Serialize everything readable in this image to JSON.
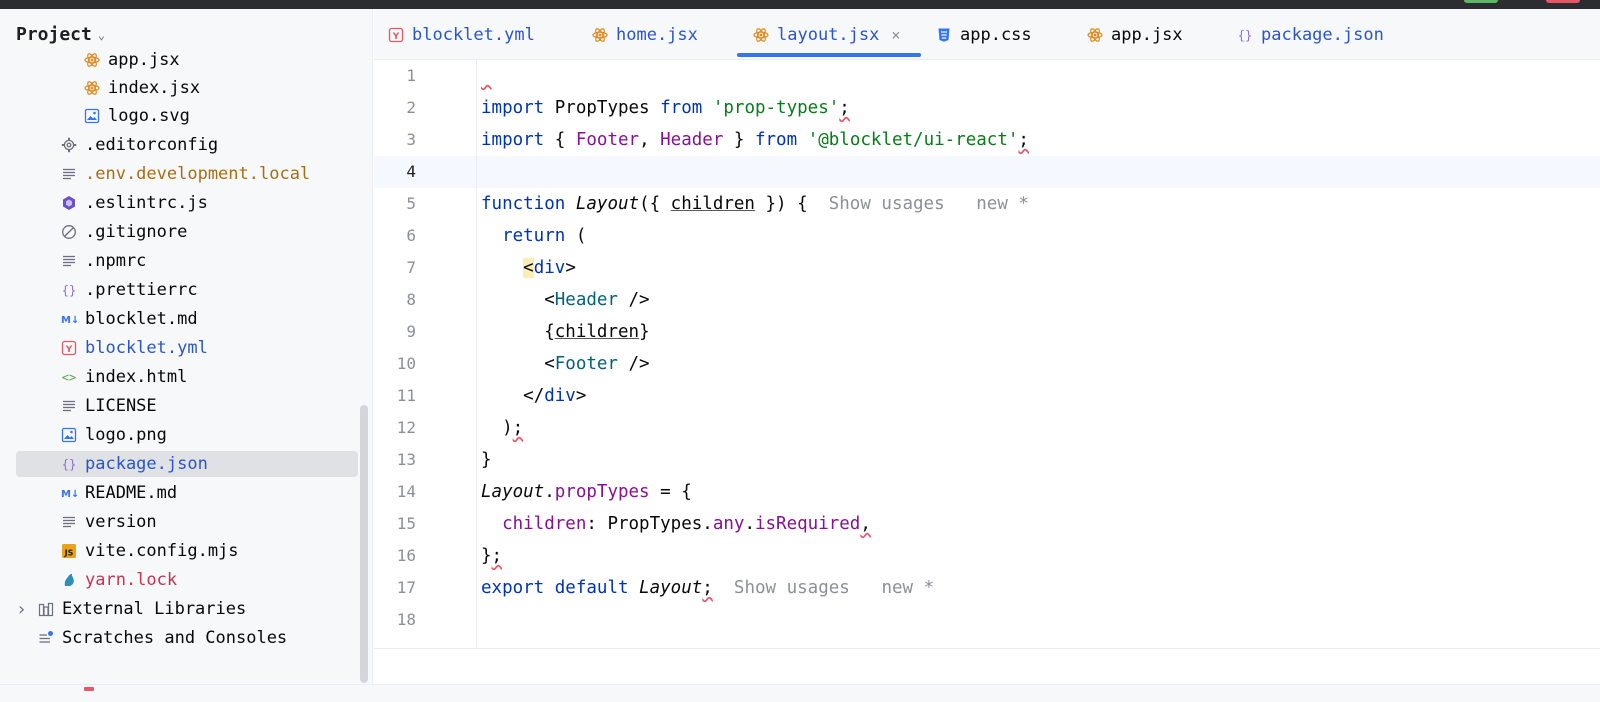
{
  "project": {
    "title": "Project"
  },
  "tree": [
    {
      "label": "app.jsx",
      "icon": "react-icon",
      "color": "#080808"
    },
    {
      "label": "index.jsx",
      "icon": "react-icon",
      "color": "#080808"
    },
    {
      "label": "logo.svg",
      "icon": "image-icon",
      "color": "#080808"
    },
    {
      "label": ".editorconfig",
      "icon": "gear-icon",
      "color": "#080808"
    },
    {
      "label": ".env.development.local",
      "icon": "text-file-icon",
      "color": "#a86d12"
    },
    {
      "label": ".eslintrc.js",
      "icon": "eslint-icon",
      "color": "#080808"
    },
    {
      "label": ".gitignore",
      "icon": "ignore-icon",
      "color": "#080808"
    },
    {
      "label": ".npmrc",
      "icon": "text-file-icon",
      "color": "#080808"
    },
    {
      "label": ".prettierrc",
      "icon": "json-icon",
      "color": "#080808"
    },
    {
      "label": "blocklet.md",
      "icon": "markdown-icon",
      "color": "#080808"
    },
    {
      "label": "blocklet.yml",
      "icon": "yaml-icon",
      "color": "#2a55c8"
    },
    {
      "label": "index.html",
      "icon": "html-icon",
      "color": "#080808"
    },
    {
      "label": "LICENSE",
      "icon": "text-file-icon",
      "color": "#080808"
    },
    {
      "label": "logo.png",
      "icon": "image-icon",
      "color": "#080808"
    },
    {
      "label": "package.json",
      "icon": "json-icon",
      "color": "#2a55c8"
    },
    {
      "label": "README.md",
      "icon": "markdown-icon",
      "color": "#080808"
    },
    {
      "label": "version",
      "icon": "text-file-icon",
      "color": "#080808"
    },
    {
      "label": "vite.config.mjs",
      "icon": "js-icon",
      "color": "#080808"
    },
    {
      "label": "yarn.lock",
      "icon": "yarn-icon",
      "color": "#c7334b"
    },
    {
      "label": "External Libraries",
      "icon": "library-icon",
      "color": "#080808"
    },
    {
      "label": "Scratches and Consoles",
      "icon": "scratches-icon",
      "color": "#080808"
    }
  ],
  "tabs": [
    {
      "label": "blocklet.yml",
      "icon": "yaml-icon",
      "color": "#2a55c8"
    },
    {
      "label": "home.jsx",
      "icon": "react-icon",
      "color": "#2a55c8"
    },
    {
      "label": "layout.jsx",
      "icon": "react-icon",
      "color": "#2a55c8",
      "active": true
    },
    {
      "label": "app.css",
      "icon": "css-icon",
      "color": "#080808"
    },
    {
      "label": "app.jsx",
      "icon": "react-icon",
      "color": "#080808"
    },
    {
      "label": "package.json",
      "icon": "json-icon",
      "color": "#2a55c8"
    }
  ],
  "editor": {
    "current_line": 4,
    "line_numbers": [
      "1",
      "2",
      "3",
      "4",
      "5",
      "6",
      "7",
      "8",
      "9",
      "10",
      "11",
      "12",
      "13",
      "14",
      "15",
      "16",
      "17",
      "18"
    ],
    "hints": {
      "show_usages": "Show usages",
      "new_star": "new *"
    },
    "code": {
      "l2_import": "import",
      "l2_proptypes": "PropTypes",
      "l2_from": "from",
      "l2_str": "'prop-types'",
      "l2_semi": ";",
      "l3_import": "import",
      "l3_open": "{ ",
      "l3_footer": "Footer",
      "l3_comma": ", ",
      "l3_header": "Header",
      "l3_close": " }",
      "l3_from": "from",
      "l3_str": "'@blocklet/ui-react'",
      "l3_semi": ";",
      "l5_function": "function",
      "l5_name": "Layout",
      "l5_open": "({ ",
      "l5_children": "children",
      "l5_close": " }) {",
      "l6_return": "return",
      "l6_paren": " (",
      "l7_lt": "<",
      "l7_div": "div",
      "l7_gt": ">",
      "l8_lt": "<",
      "l8_header": "Header",
      "l8_close": " />",
      "l9_open": "{",
      "l9_children": "children",
      "l9_close": "}",
      "l10_lt": "<",
      "l10_footer": "Footer",
      "l10_close": " />",
      "l11_lt": "</",
      "l11_div": "div",
      "l11_gt": ">",
      "l12_paren": ")",
      "l12_semi": ";",
      "l13_brace": "}",
      "l14_name": "Layout",
      "l14_dot": ".",
      "l14_prop": "propTypes",
      "l14_eq": " = {",
      "l15_key": "children",
      "l15_colon": ": ",
      "l15_pt": "PropTypes",
      "l15_dot": ".",
      "l15_any": "any",
      "l15_dot2": ".",
      "l15_req": "isRequired",
      "l15_comma": ",",
      "l16_close": "}",
      "l16_semi": ";",
      "l17_export": "export",
      "l17_default": "default",
      "l17_name": "Layout",
      "l17_semi": ";"
    }
  }
}
